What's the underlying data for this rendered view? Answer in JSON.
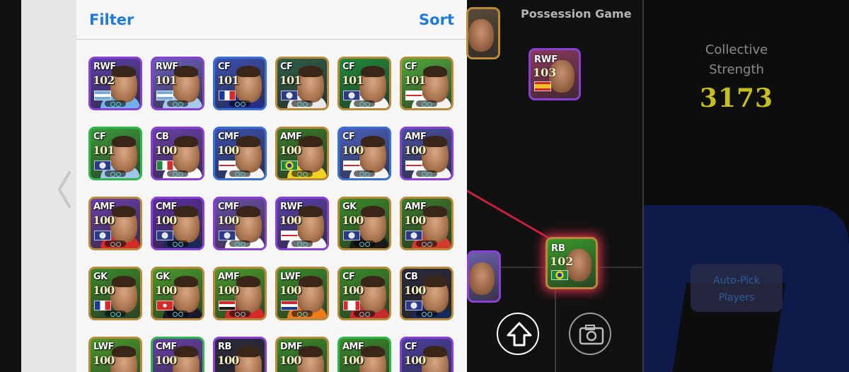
{
  "list": {
    "filter_label": "Filter",
    "sort_label": "Sort",
    "cards": [
      {
        "position": "RWF",
        "rating": "102",
        "flag": "argentina",
        "frame": "#8a3fd6",
        "bg": "#5a3fa8",
        "shirt": "#6fb2e8"
      },
      {
        "position": "RWF",
        "rating": "101",
        "flag": "argentina",
        "frame": "#8a3fd6",
        "bg": "#6b5fbd",
        "shirt": "#a6c8ea"
      },
      {
        "position": "CF",
        "rating": "101",
        "flag": "france",
        "frame": "#3b6fd6",
        "bg": "#3b4fb0",
        "shirt": "#25308a"
      },
      {
        "position": "CF",
        "rating": "101",
        "flag": "club",
        "frame": "#b98a3a",
        "bg": "#2e5d48",
        "shirt": "#e9e9e9"
      },
      {
        "position": "CF",
        "rating": "101",
        "flag": "club",
        "frame": "#b98a3a",
        "bg": "#1f8a3a",
        "shirt": "#f4f4f4"
      },
      {
        "position": "CF",
        "rating": "101",
        "flag": "england",
        "frame": "#b98a3a",
        "bg": "#4fa83a",
        "shirt": "#f2f2f2"
      },
      {
        "position": "CF",
        "rating": "101",
        "flag": "club",
        "frame": "#2fb84a",
        "bg": "#3a9a3a",
        "shirt": "#9fc6e6"
      },
      {
        "position": "CB",
        "rating": "100",
        "flag": "italy",
        "frame": "#8a3fd6",
        "bg": "#6a3faa",
        "shirt": "#ffffff"
      },
      {
        "position": "CMF",
        "rating": "100",
        "flag": "england",
        "frame": "#3b6fd6",
        "bg": "#3b4fb0",
        "shirt": "#f4f4f4"
      },
      {
        "position": "AMF",
        "rating": "100",
        "flag": "brazil",
        "frame": "#b98a3a",
        "bg": "#3a7a2a",
        "shirt": "#f2d21e"
      },
      {
        "position": "CF",
        "rating": "100",
        "flag": "england",
        "frame": "#3b6fd6",
        "bg": "#4a5fbd",
        "shirt": "#f4f4f4"
      },
      {
        "position": "AMF",
        "rating": "100",
        "flag": "england",
        "frame": "#8a3fd6",
        "bg": "#4a4fa0",
        "shirt": "#f4f4f4"
      },
      {
        "position": "AMF",
        "rating": "100",
        "flag": "club",
        "frame": "#b98a3a",
        "bg": "#6a3faa",
        "shirt": "#d62a2a"
      },
      {
        "position": "CMF",
        "rating": "100",
        "flag": "club",
        "frame": "#8a3fd6",
        "bg": "#5a2fa0",
        "shirt": "#1a2a5a"
      },
      {
        "position": "CMF",
        "rating": "100",
        "flag": "club",
        "frame": "#8a3fd6",
        "bg": "#6a4faa",
        "shirt": "#ffffff"
      },
      {
        "position": "RWF",
        "rating": "100",
        "flag": "england",
        "frame": "#8a3fd6",
        "bg": "#5a3fa8",
        "shirt": "#f4f4f4"
      },
      {
        "position": "GK",
        "rating": "100",
        "flag": "club",
        "frame": "#b98a3a",
        "bg": "#3a8a2a",
        "shirt": "#1a1a1a"
      },
      {
        "position": "AMF",
        "rating": "100",
        "flag": "club",
        "frame": "#b98a3a",
        "bg": "#3a7a2a",
        "shirt": "#d63a2a"
      },
      {
        "position": "GK",
        "rating": "100",
        "flag": "france",
        "frame": "#b98a3a",
        "bg": "#3a8a2a",
        "shirt": "#2a4a2a"
      },
      {
        "position": "GK",
        "rating": "100",
        "flag": "switzerland",
        "frame": "#b98a3a",
        "bg": "#4a9a2a",
        "shirt": "#1a1a2a"
      },
      {
        "position": "AMF",
        "rating": "100",
        "flag": "egypt",
        "frame": "#b98a3a",
        "bg": "#4a9a2a",
        "shirt": "#d62a2a"
      },
      {
        "position": "LWF",
        "rating": "100",
        "flag": "netherlands",
        "frame": "#b98a3a",
        "bg": "#3a8a2a",
        "shirt": "#ee7a1a"
      },
      {
        "position": "CF",
        "rating": "100",
        "flag": "canada",
        "frame": "#b98a3a",
        "bg": "#3a8a2a",
        "shirt": "#c62a2a"
      },
      {
        "position": "CB",
        "rating": "100",
        "flag": "club",
        "frame": "#b98a3a",
        "bg": "#2a2a3a",
        "shirt": "#1a2a5a"
      },
      {
        "position": "LWF",
        "rating": "100",
        "flag": "none",
        "frame": "#b98a3a",
        "bg": "#4a9a2a",
        "shirt": "#d8d8d8"
      },
      {
        "position": "CMF",
        "rating": "100",
        "flag": "none",
        "frame": "#2fb84a",
        "bg": "#6a3faa",
        "shirt": "#d62a2a"
      },
      {
        "position": "RB",
        "rating": "100",
        "flag": "none",
        "frame": "#8a3fd6",
        "bg": "#2a2a3a",
        "shirt": "#1a1a1a"
      },
      {
        "position": "DMF",
        "rating": "100",
        "flag": "none",
        "frame": "#b98a3a",
        "bg": "#3a8a2a",
        "shirt": "#c62a2a"
      },
      {
        "position": "AMF",
        "rating": "100",
        "flag": "none",
        "frame": "#2fb84a",
        "bg": "#3a8a2a",
        "shirt": "#d62a2a"
      },
      {
        "position": "CF",
        "rating": "100",
        "flag": "none",
        "frame": "#8a3fd6",
        "bg": "#4a3fa0",
        "shirt": "#1a1a1a"
      }
    ]
  },
  "formation": {
    "title": "Possession Game",
    "players": [
      {
        "position": "",
        "rating": "",
        "flag": "none",
        "frame": "#b98a3a",
        "bg": "#5a4a3a"
      },
      {
        "position": "RWF",
        "rating": "103",
        "flag": "spain",
        "frame": "#8a3fd6",
        "bg": "#8a3a5a"
      },
      {
        "position": "",
        "rating": "",
        "flag": "none",
        "frame": "#8a3fd6",
        "bg": "#6a5faa"
      },
      {
        "position": "RB",
        "rating": "102",
        "flag": "brazil",
        "frame": "#b98a3a",
        "bg": "#3a9a2a"
      }
    ]
  },
  "summary": {
    "strength_label": "Collective\nStrength",
    "strength_value": "3173",
    "autopick_label": "Auto-Pick\nPlayers"
  },
  "colors": {
    "accent_blue": "#1f7ad9",
    "strength_yellow": "#c6bf1a",
    "highlight_red": "#c81f3a"
  }
}
